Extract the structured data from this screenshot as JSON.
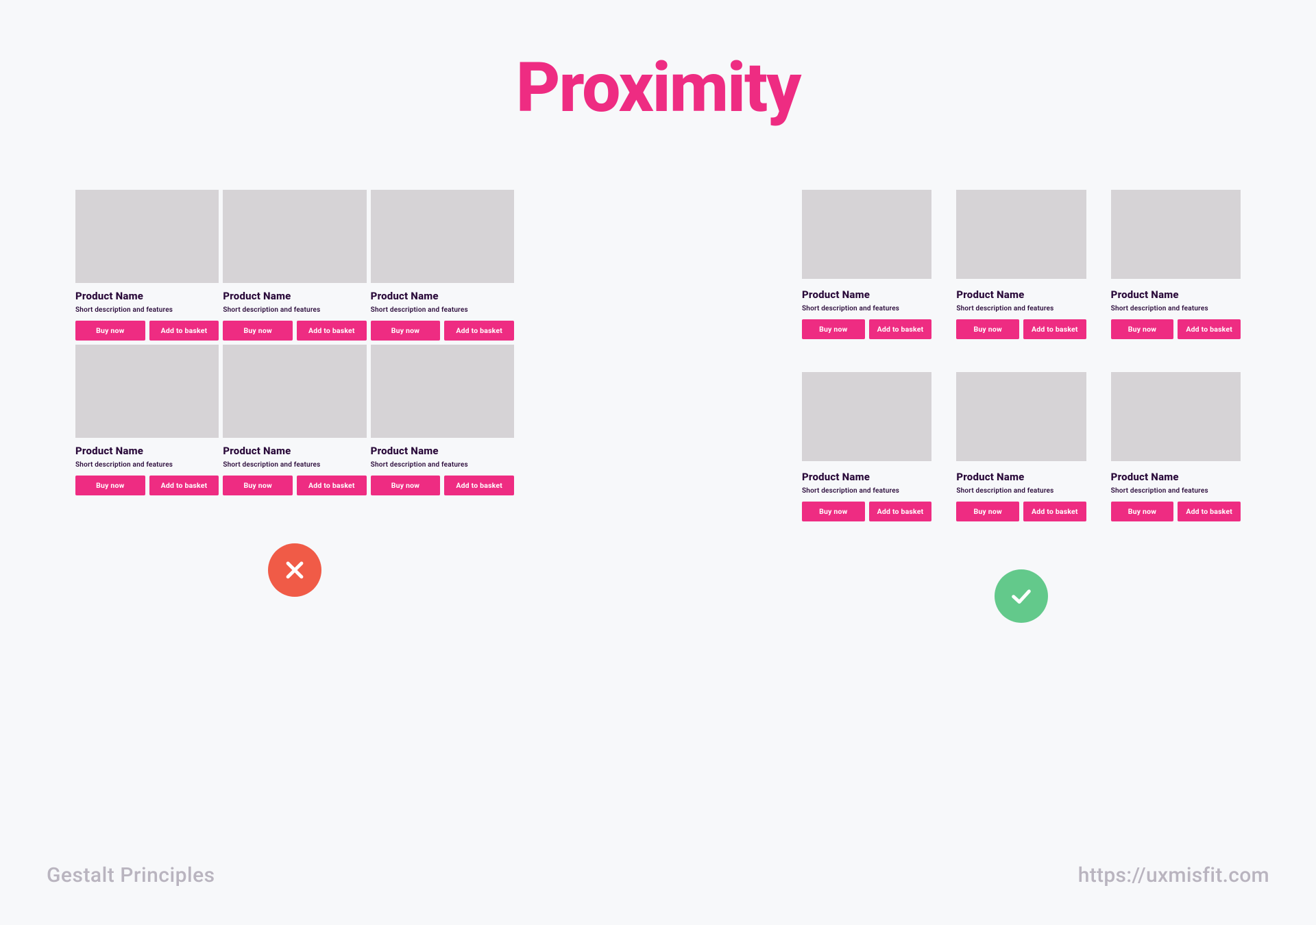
{
  "title": "Proximity",
  "footer": {
    "left": "Gestalt Principles",
    "right": "https://uxmisfit.com"
  },
  "labels": {
    "product_name": "Product Name",
    "description": "Short description and features",
    "buy": "Buy now",
    "add": "Add to basket"
  },
  "card_count": 6,
  "colors": {
    "accent": "#ee2c82",
    "bad": "#f05b47",
    "good": "#63c98b",
    "placeholder": "#d6d3d6",
    "muted": "#b9b4bf",
    "ink": "#2a0a3a",
    "bg": "#f7f8fa"
  }
}
